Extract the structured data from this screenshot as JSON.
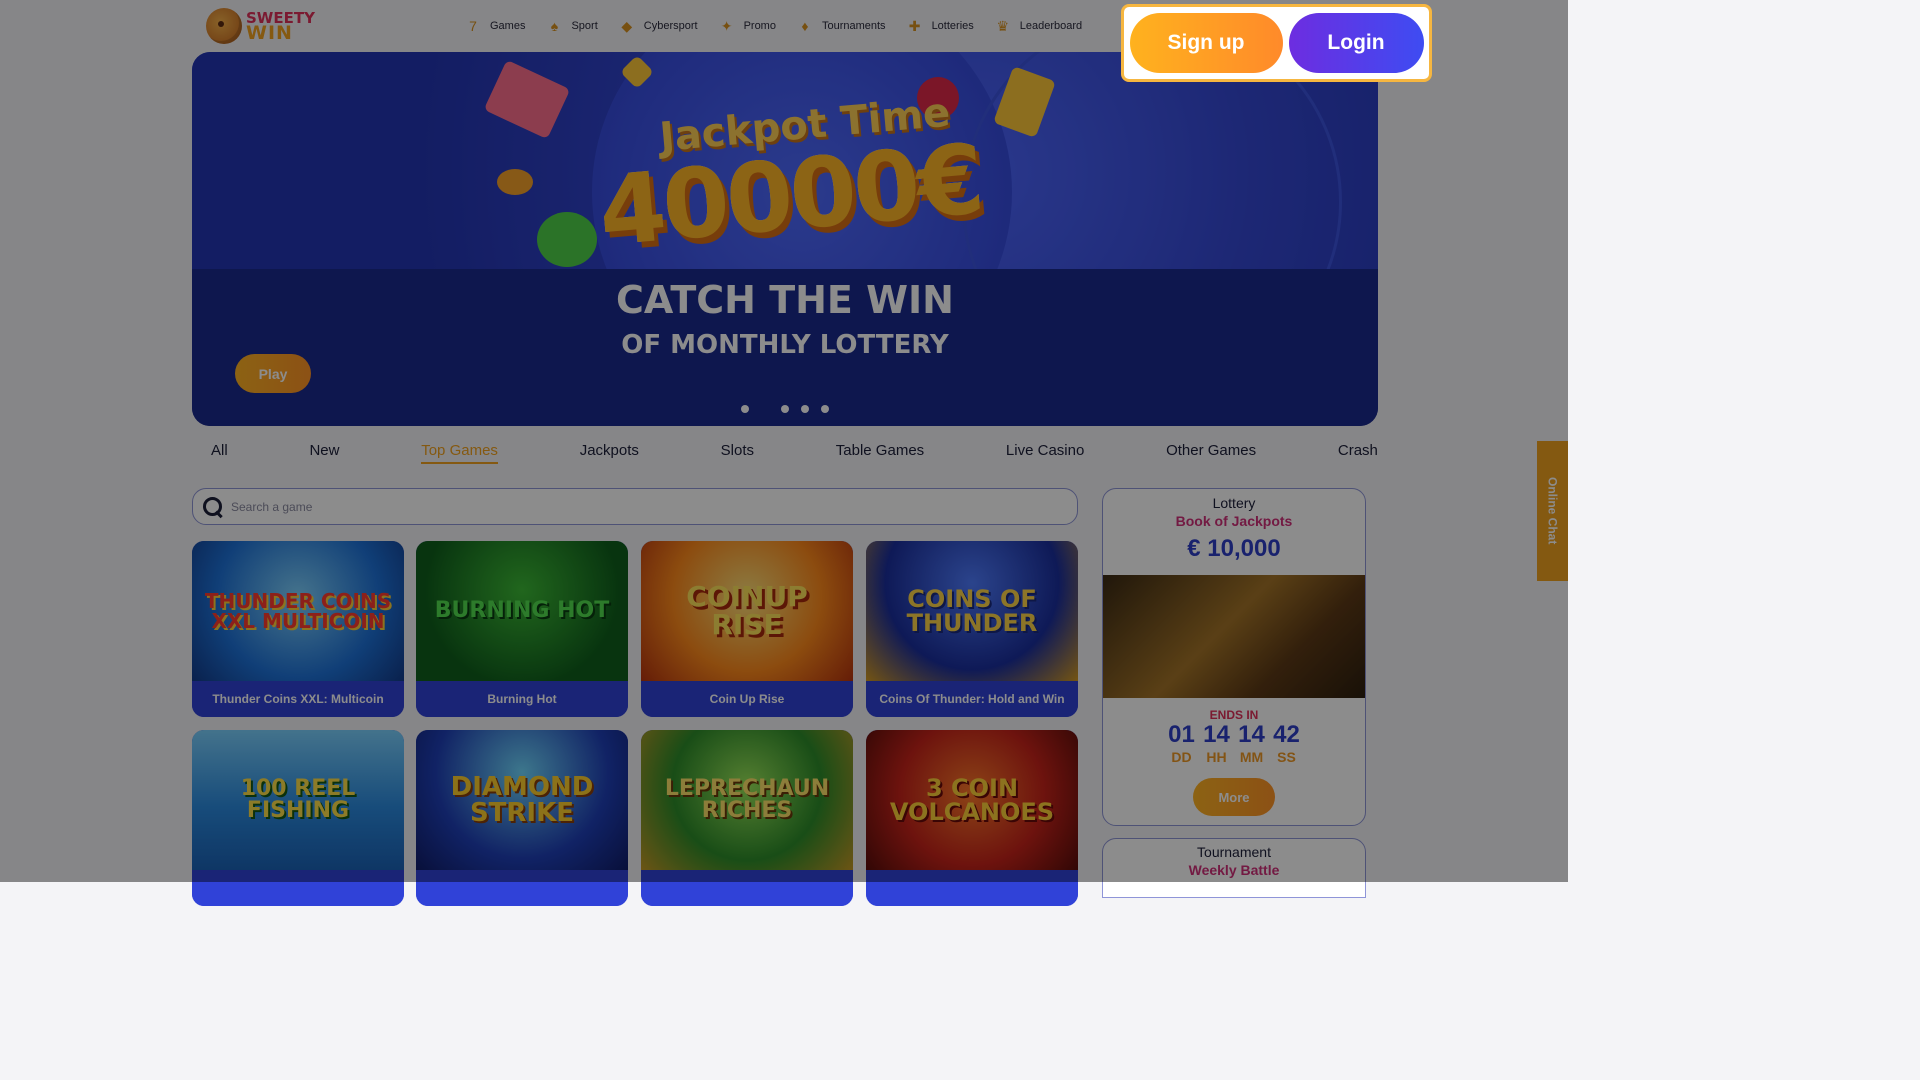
{
  "brand": {
    "line1": "SWEETY",
    "line2": "WIN"
  },
  "nav": [
    {
      "label": "Games",
      "icon": "7"
    },
    {
      "label": "Sport",
      "icon": "♠"
    },
    {
      "label": "Cybersport",
      "icon": "◆"
    },
    {
      "label": "Promo",
      "icon": "✦"
    },
    {
      "label": "Tournaments",
      "icon": "♦"
    },
    {
      "label": "Lotteries",
      "icon": "✚"
    },
    {
      "label": "Leaderboard",
      "icon": "♛"
    }
  ],
  "auth": {
    "signup": "Sign up",
    "login": "Login"
  },
  "hero": {
    "title_small": "Jackpot Time",
    "amount": "40000€",
    "headline": "CATCH THE WIN",
    "subheadline": "OF MONTHLY LOTTERY",
    "play": "Play"
  },
  "categories": [
    "All",
    "New",
    "Top Games",
    "Jackpots",
    "Slots",
    "Table Games",
    "Live Casino",
    "Other Games",
    "Crash"
  ],
  "active_category": "Top Games",
  "search": {
    "placeholder": "Search a game"
  },
  "games": [
    {
      "art": "THUNDER COINS XXL MULTICOIN",
      "title": "Thunder Coins XXL: Multicoin"
    },
    {
      "art": "BURNING HOT",
      "title": "Burning Hot"
    },
    {
      "art": "COINUP RISE",
      "title": "Coin Up Rise"
    },
    {
      "art": "COINS OF THUNDER",
      "title": "Coins Of Thunder: Hold and Win"
    },
    {
      "art": "100 REEL FISHING",
      "title": ""
    },
    {
      "art": "DIAMOND STRIKE",
      "title": ""
    },
    {
      "art": "LEPRECHAUN RICHES",
      "title": ""
    },
    {
      "art": "3 COIN VOLCANOES",
      "title": ""
    }
  ],
  "lottery": {
    "kicker": "Lottery",
    "name": "Book of Jackpots",
    "amount": "€ 10,000",
    "ends_label": "ENDS IN",
    "timer": [
      {
        "value": "01",
        "unit": "DD"
      },
      {
        "value": "14",
        "unit": "HH"
      },
      {
        "value": "14",
        "unit": "MM"
      },
      {
        "value": "42",
        "unit": "SS"
      }
    ],
    "more": "More"
  },
  "tournament": {
    "kicker": "Tournament",
    "name": "Weekly Battle"
  },
  "chat": {
    "label": "Online Chat"
  },
  "colors": {
    "accent": "#f2a320",
    "primary": "#2f3fc8",
    "pink": "#d1317a"
  }
}
